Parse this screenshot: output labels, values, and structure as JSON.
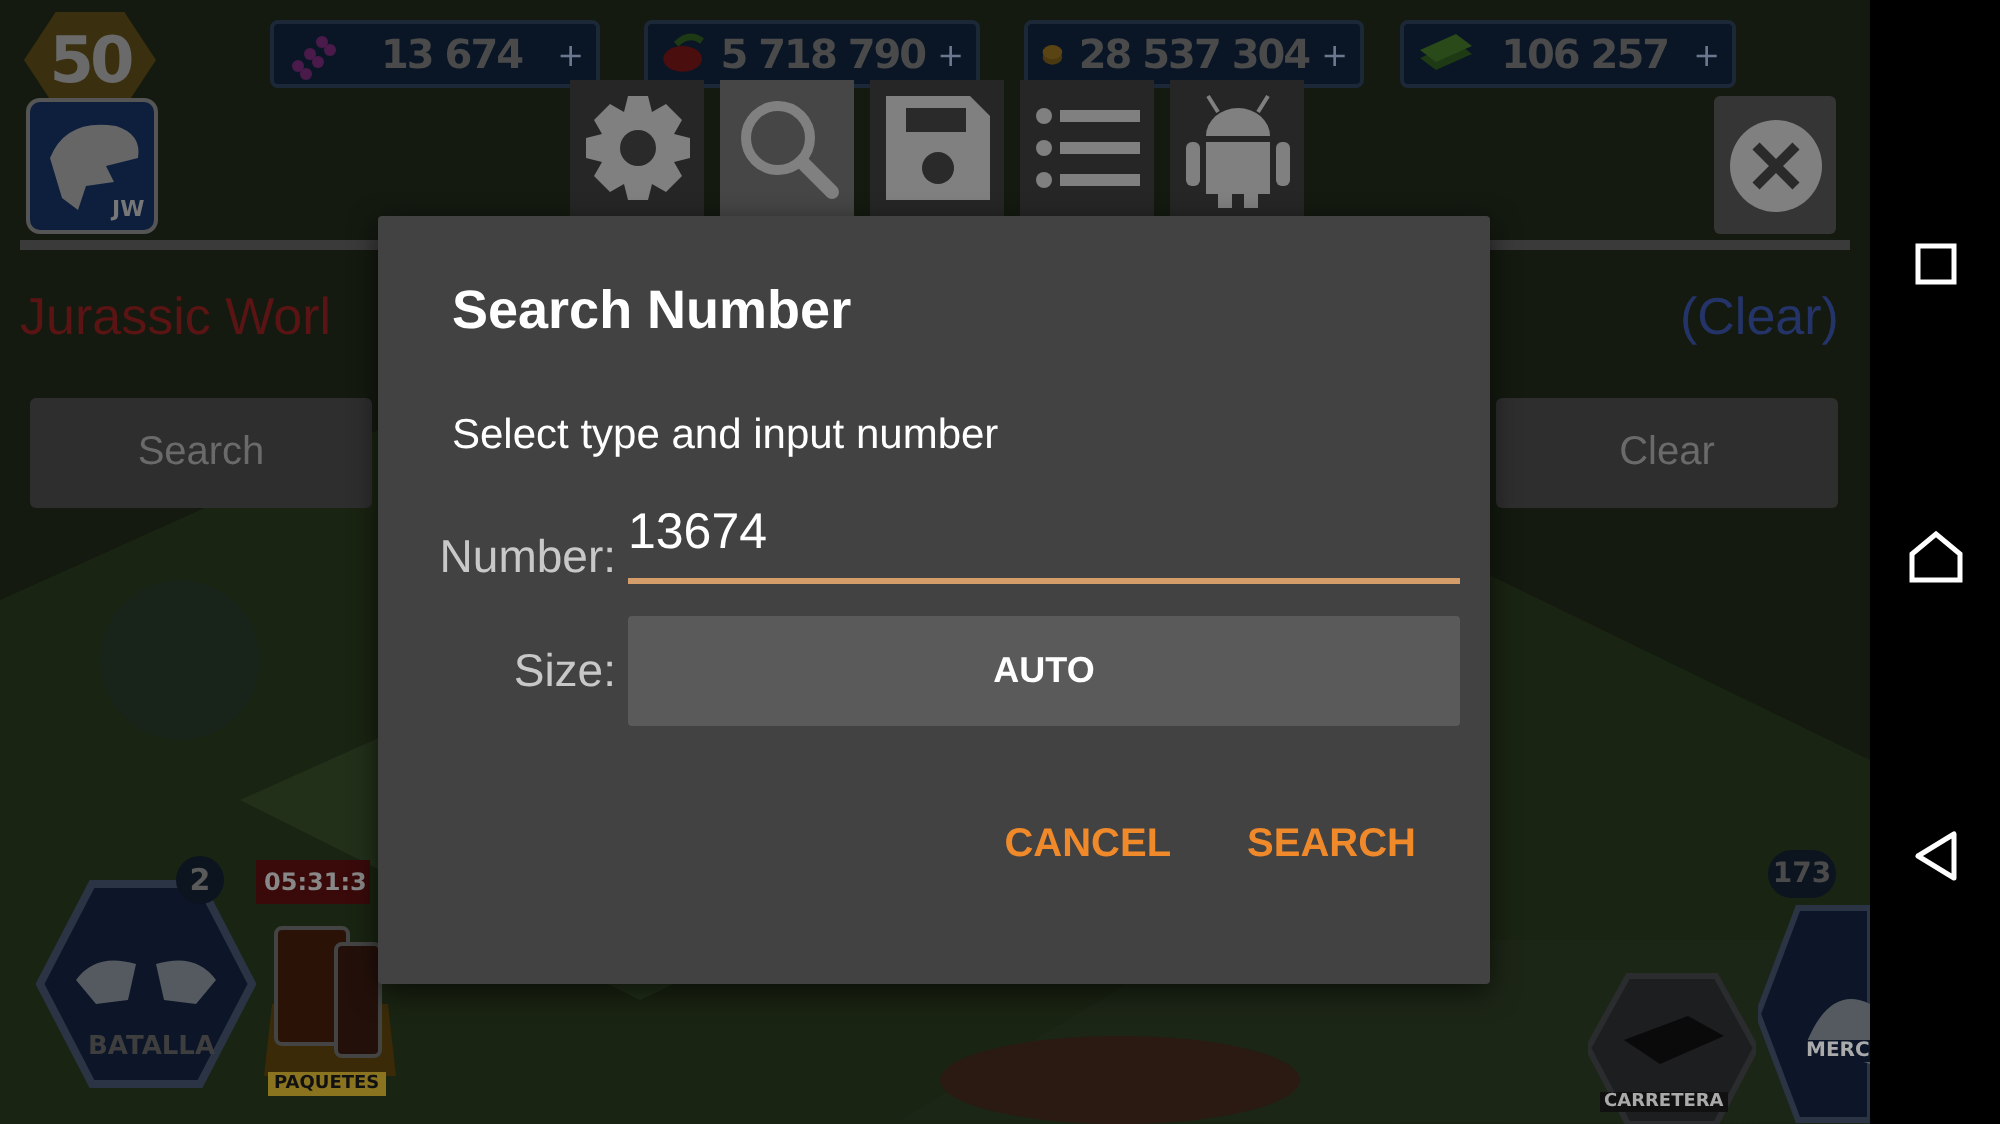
{
  "game": {
    "level": "50",
    "logo_text": "JW",
    "resources": [
      {
        "kind": "dna",
        "value": "13 674",
        "plus": "+"
      },
      {
        "kind": "food",
        "value": "5 718 790",
        "plus": "+"
      },
      {
        "kind": "coins",
        "value": "28 537 304",
        "plus": "+"
      },
      {
        "kind": "cash",
        "value": "106 257",
        "plus": "+"
      }
    ],
    "battle": {
      "badge": "2",
      "label": "BATALLA"
    },
    "packs": {
      "timer": "05:31:3",
      "label": "PAQUETES"
    },
    "road": {
      "label": "CARRETERA"
    },
    "market": {
      "badge": "173",
      "label": "MERC"
    }
  },
  "overlay": {
    "toolbar": [
      {
        "kind": "settings",
        "selected": false
      },
      {
        "kind": "search",
        "selected": true
      },
      {
        "kind": "save",
        "selected": false
      },
      {
        "kind": "list",
        "selected": false
      },
      {
        "kind": "android",
        "selected": false
      }
    ],
    "app_title": "Jurassic Worl",
    "clear_link": "(Clear)",
    "buttons": [
      "Search",
      "Clear"
    ]
  },
  "dialog": {
    "title": "Search Number",
    "message": "Select type and input number",
    "number": {
      "label": "Number:",
      "value": "13674"
    },
    "size": {
      "label": "Size:",
      "value": "AUTO"
    },
    "actions": [
      "CANCEL",
      "SEARCH"
    ]
  },
  "nav_bar": [
    {
      "kind": "recents"
    },
    {
      "kind": "home"
    },
    {
      "kind": "back"
    }
  ]
}
